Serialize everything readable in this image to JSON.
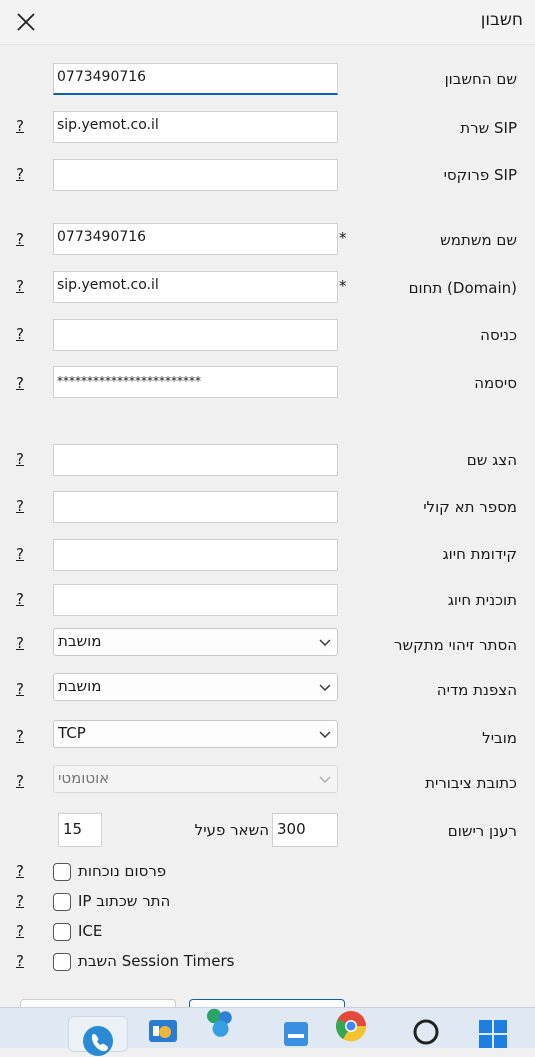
{
  "window": {
    "title": "חשבון"
  },
  "fields": {
    "account_name": {
      "label": "שם החשבון",
      "value": "0773490716"
    },
    "sip_server": {
      "label": "SIP שרת",
      "value": "sip.yemot.co.il",
      "help": "?"
    },
    "sip_proxy": {
      "label": "SIP פרוקסי",
      "value": "",
      "help": "?"
    },
    "username": {
      "label": "שם משתמש",
      "value": "0773490716",
      "help": "?",
      "required": "*"
    },
    "domain": {
      "label": "(Domain) תחום",
      "value": "sip.yemot.co.il",
      "help": "?",
      "required": "*"
    },
    "login": {
      "label": "כניסה",
      "value": "",
      "help": "?"
    },
    "password": {
      "label": "סיסמה",
      "value": "************************",
      "help": "?"
    },
    "display_name": {
      "label": "הצג שם",
      "value": "",
      "help": "?"
    },
    "voicemail": {
      "label": "מספר תא קולי",
      "value": "",
      "help": "?"
    },
    "dial_prefix": {
      "label": "קידומת חיוג",
      "value": "",
      "help": "?"
    },
    "dial_plan": {
      "label": "תוכנית חיוג",
      "value": "",
      "help": "?"
    }
  },
  "selects": {
    "hide_caller_id": {
      "label": "הסתר זיהוי מתקשר",
      "value": "מושבת",
      "help": "?"
    },
    "media_encryption": {
      "label": "הצפנת מדיה",
      "value": "מושבת",
      "help": "?"
    },
    "transport": {
      "label": "מוביל",
      "value": "TCP",
      "help": "?"
    },
    "public_address": {
      "label": "כתובת ציבורית",
      "value": "אוטומטי",
      "help": "?"
    }
  },
  "registration": {
    "label": "רענן רישום",
    "interval": "300",
    "keepalive_label": "השאר פעיל",
    "keepalive": "15"
  },
  "checkboxes": [
    {
      "label": "פרסום נוכחות",
      "help": "?",
      "checked": false
    },
    {
      "label": "IP התר שכתוב",
      "help": "?",
      "checked": false
    },
    {
      "label": "ICE",
      "help": "?",
      "checked": false
    },
    {
      "label": "השבת Session Timers",
      "help": "?",
      "checked": false
    }
  ],
  "colors": {
    "accent": "#0e5fa8",
    "background": "#f0f0f0"
  }
}
